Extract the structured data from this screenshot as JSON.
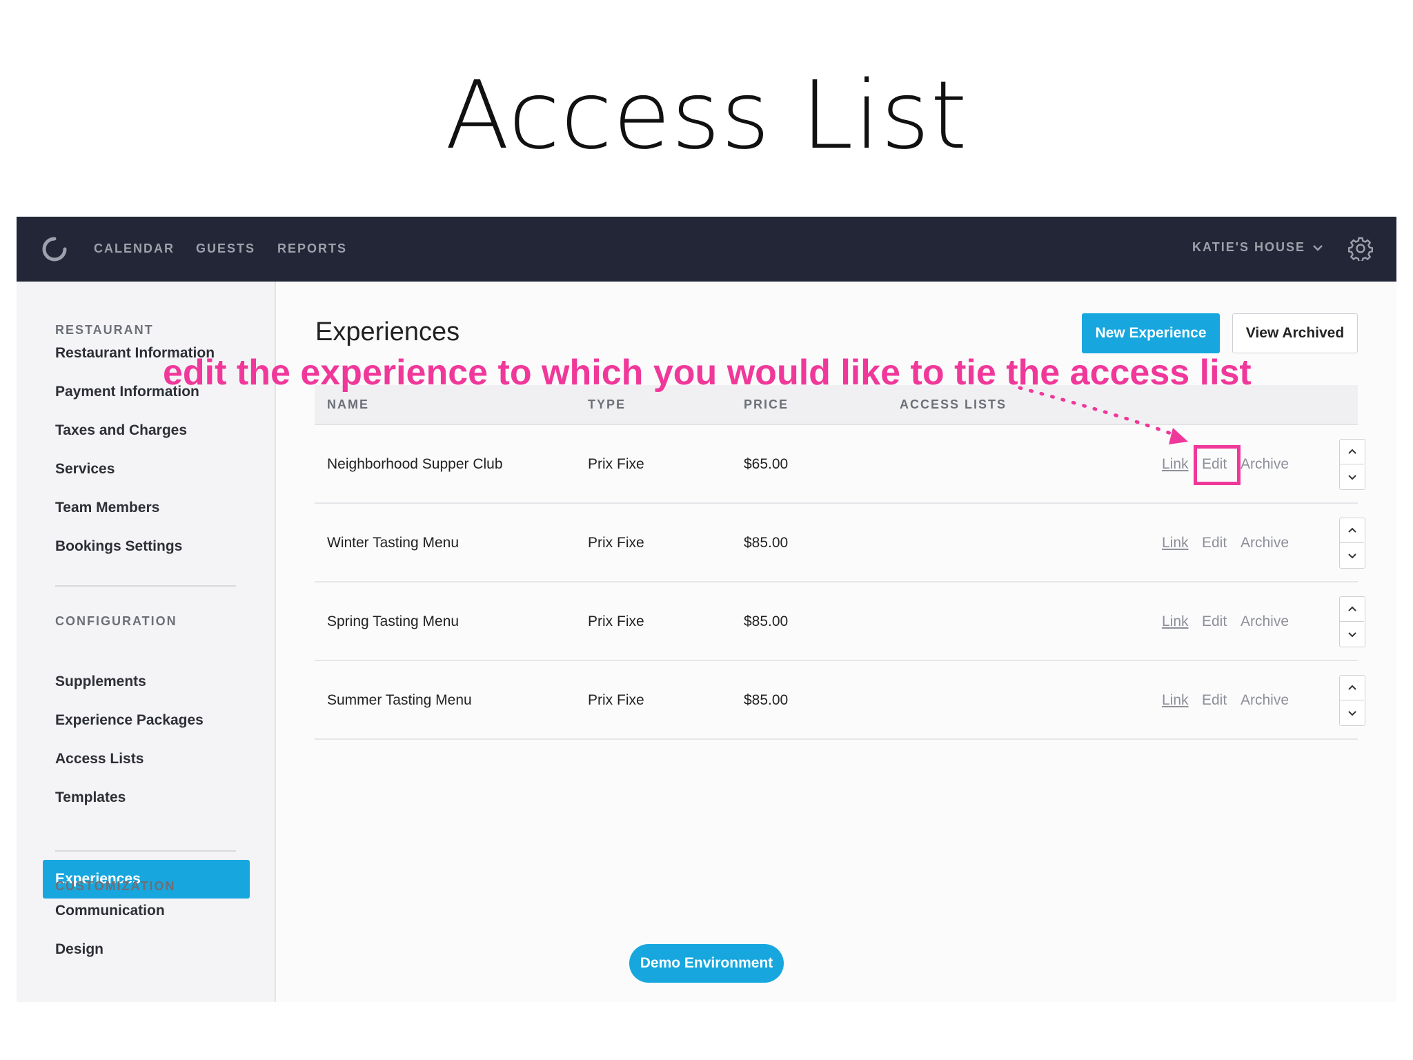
{
  "slide": {
    "title": "Access List"
  },
  "topbar": {
    "nav": [
      "CALENDAR",
      "GUESTS",
      "REPORTS"
    ],
    "restaurant_selector": "KATIE'S HOUSE",
    "logo_icon": "circle-logo-icon",
    "settings_icon": "gear-icon",
    "background": "#222636"
  },
  "sidebar": {
    "sections": [
      {
        "title": "RESTAURANT",
        "items": [
          "Restaurant Information",
          "Payment Information",
          "Taxes and Charges",
          "Services",
          "Team Members",
          "Bookings Settings"
        ]
      },
      {
        "title": "CONFIGURATION",
        "items": [
          "Experiences",
          "Supplements",
          "Experience Packages",
          "Access Lists",
          "Templates"
        ],
        "active": "Experiences"
      },
      {
        "title": "CUSTOMIZATION",
        "items": [
          "Communication",
          "Design"
        ]
      }
    ],
    "accent": "#17a7de"
  },
  "main": {
    "heading": "Experiences",
    "new_button": "New Experience",
    "archived_button": "View Archived",
    "columns": [
      "NAME",
      "TYPE",
      "PRICE",
      "ACCESS LISTS"
    ],
    "rows": [
      {
        "name": "Neighborhood Supper Club",
        "type": "Prix Fixe",
        "price": "$65.00",
        "access_lists": ""
      },
      {
        "name": "Winter Tasting Menu",
        "type": "Prix Fixe",
        "price": "$85.00",
        "access_lists": ""
      },
      {
        "name": "Spring Tasting Menu",
        "type": "Prix Fixe",
        "price": "$85.00",
        "access_lists": ""
      },
      {
        "name": "Summer Tasting Menu",
        "type": "Prix Fixe",
        "price": "$85.00",
        "access_lists": ""
      }
    ],
    "row_actions": {
      "link": "Link",
      "edit": "Edit",
      "archive": "Archive"
    }
  },
  "demo_badge": "Demo Environment",
  "annotation": {
    "text": "edit the experience to which you would like to tie the access list",
    "color": "#f0389a"
  }
}
